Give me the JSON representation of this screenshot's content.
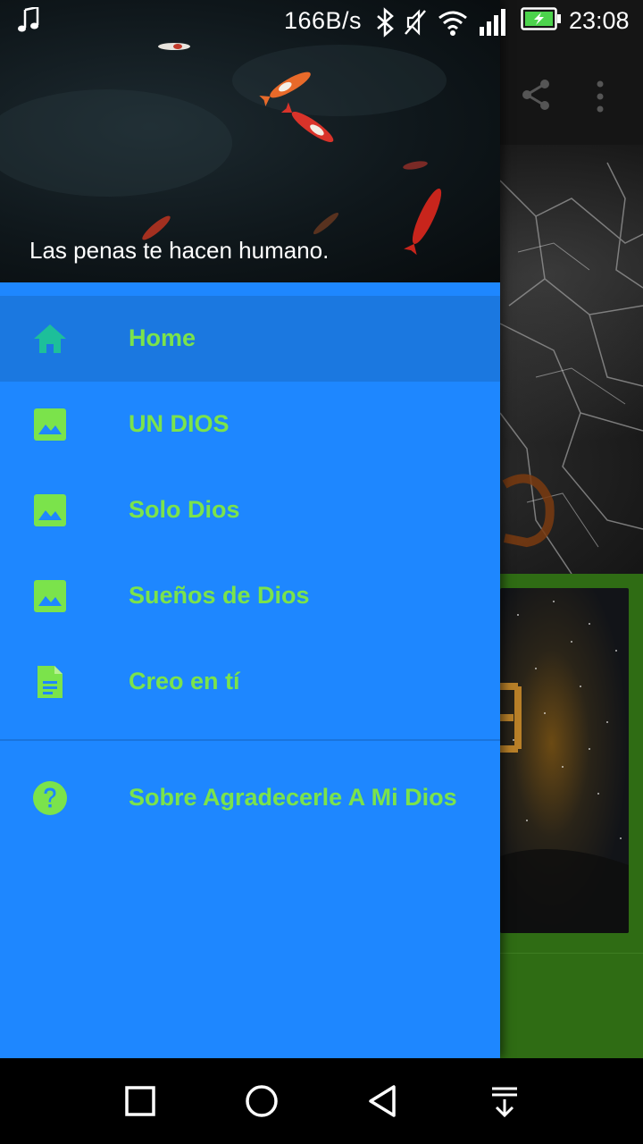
{
  "status_bar": {
    "net_speed": "166B/s",
    "time": "23:08",
    "icons": [
      "music-note-icon",
      "bluetooth-icon",
      "mute-icon",
      "wifi-icon",
      "signal-icon",
      "battery-charging-icon"
    ]
  },
  "drawer": {
    "header_quote": "Las penas te hacen humano.",
    "items": [
      {
        "label": "Home",
        "icon": "home-icon",
        "active": true
      },
      {
        "label": "UN DIOS",
        "icon": "image-icon"
      },
      {
        "label": "Solo Dios",
        "icon": "image-icon"
      },
      {
        "label": "Sueños de Dios",
        "icon": "image-icon"
      },
      {
        "label": "Creo en tí",
        "icon": "document-icon"
      }
    ],
    "secondary_items": [
      {
        "label": "Sobre Agradecerle A Mi Dios",
        "icon": "help-icon"
      }
    ]
  },
  "background_app": {
    "toolbar_icons": [
      "share-icon",
      "more-vert-icon"
    ]
  },
  "nav_bar": {
    "buttons": [
      "recents-square-icon",
      "home-circle-icon",
      "back-triangle-icon",
      "notifications-pulldown-icon"
    ]
  },
  "colors": {
    "drawer_bg": "#1e87ff",
    "active_item_bg": "#1b78e0",
    "label_green": "#7be34b",
    "home_icon_teal": "#1dbf9a",
    "app_green": "#2f6c14"
  }
}
